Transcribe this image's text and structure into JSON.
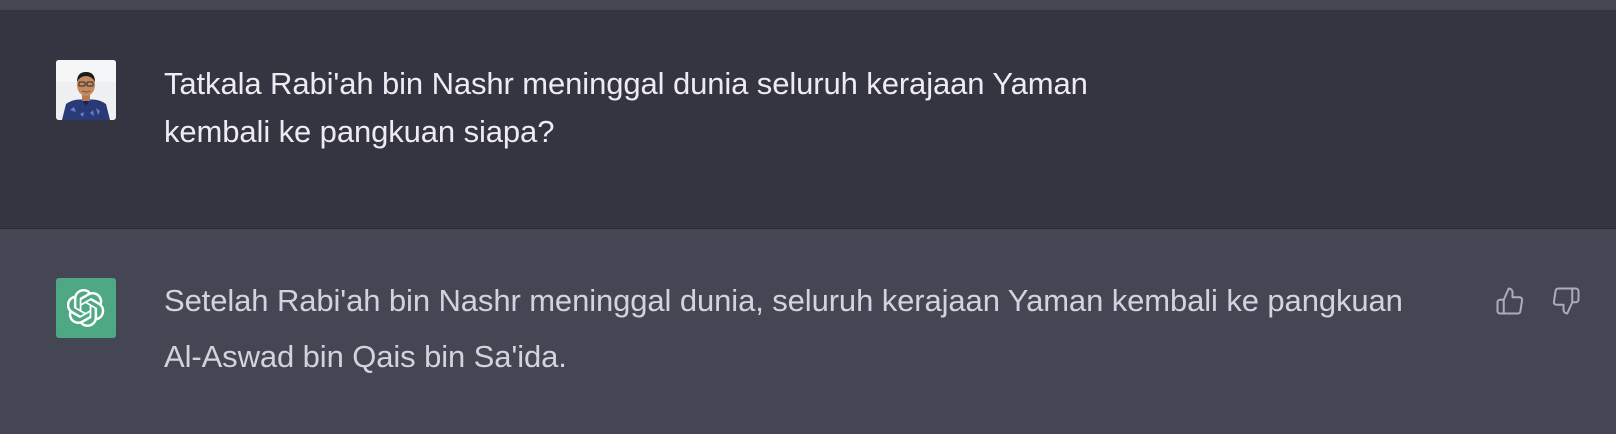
{
  "conversation": {
    "user_message": {
      "line1": "Tatkala Rabi'ah bin Nashr meninggal dunia seluruh kerajaan Yaman",
      "line2": "kembali ke pangkuan siapa?"
    },
    "assistant_message": {
      "line1": "Setelah Rabi'ah bin Nashr meninggal dunia, seluruh kerajaan Yaman kembali ke pangkuan",
      "line2": "Al-Aswad bin Qais bin Sa'ida."
    }
  },
  "icons": {
    "user_avatar": "user-photo-avatar",
    "bot_avatar": "openai-logo-icon",
    "thumbs_up": "thumbs-up-icon",
    "thumbs_down": "thumbs-down-icon"
  },
  "colors": {
    "user_row_bg": "#343541",
    "assistant_row_bg": "#444654",
    "bot_avatar_bg": "#4ea883",
    "text": "#ececf1"
  }
}
